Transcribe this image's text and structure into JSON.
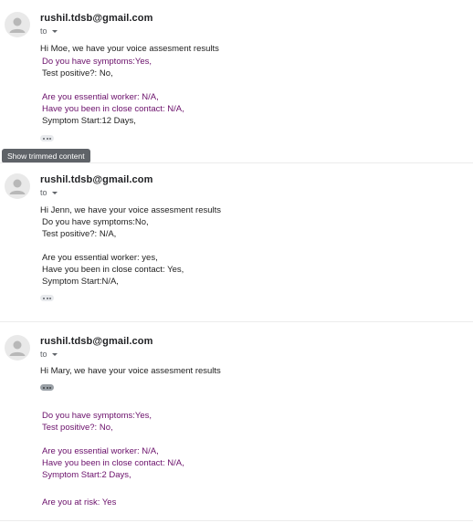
{
  "tooltip": "Show trimmed content",
  "messages": [
    {
      "sender": "rushil.tdsb@gmail.com",
      "to": "to",
      "greeting": "Hi Moe, we have your voice assesment results",
      "lines": [
        "Do you have symptoms:Yes,",
        "Test positive?: No,",
        "Are you essential worker: N/A,",
        "Have you been in close contact: N/A,",
        "Symptom Start:12 Days,"
      ]
    },
    {
      "sender": "rushil.tdsb@gmail.com",
      "to": "to",
      "greeting": "Hi Jenn, we have your voice assesment results",
      "lines": [
        "Do you have symptoms:No,",
        "Test positive?: N/A,",
        "Are you essential worker: yes,",
        "Have you been in close contact: Yes,",
        "Symptom Start:N/A,"
      ]
    },
    {
      "sender": "rushil.tdsb@gmail.com",
      "to": "to",
      "greeting": "Hi Mary, we have your voice assesment results",
      "lines": [
        "Do you have symptoms:Yes,",
        "Test positive?: No,",
        "Are you essential worker: N/A,",
        "Have you been in close contact: N/A,",
        "Symptom Start:2 Days,",
        "Are you at risk: Yes"
      ]
    }
  ],
  "colors": {
    "quoted_text": "#6a0f6a",
    "body_text": "#222222",
    "tooltip_bg": "#5f6368"
  },
  "icons": {
    "avatar": "person-avatar-icon",
    "expand": "ellipsis-icon",
    "recipients": "caret-down-icon"
  }
}
